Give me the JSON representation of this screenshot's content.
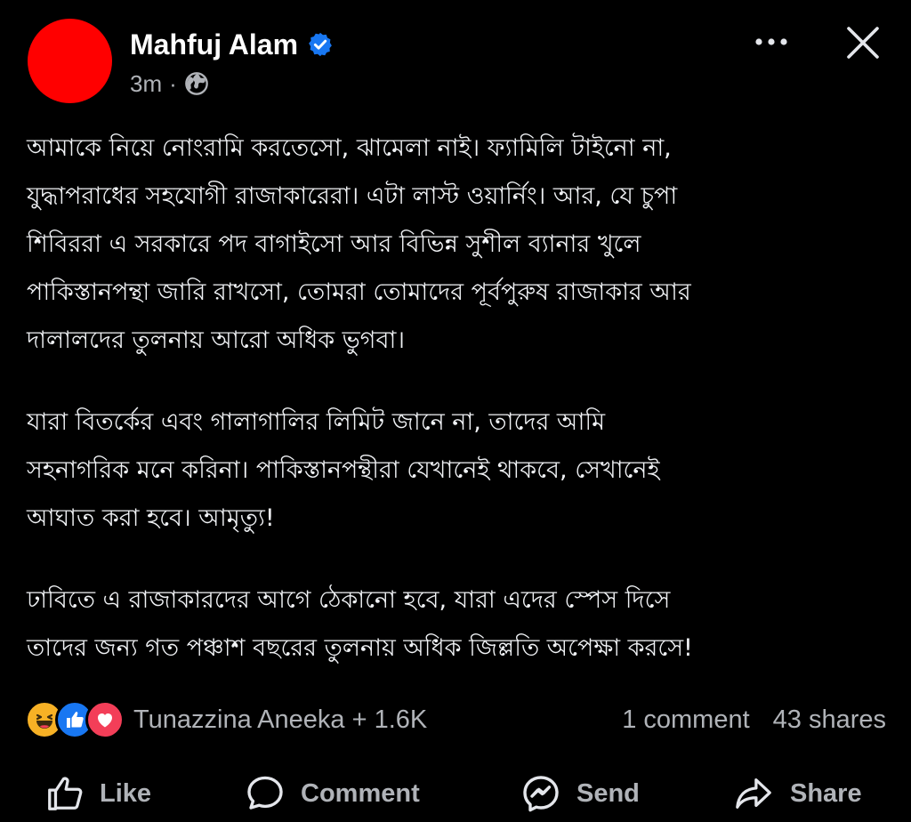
{
  "post": {
    "author": {
      "name": "Mahfuj Alam",
      "avatar_color": "#ff0000",
      "verified_icon": "verified-badge-icon",
      "verified_color": "#1877f2"
    },
    "meta": {
      "time": "3m",
      "separator": "·",
      "audience_icon": "globe-icon"
    },
    "body": {
      "paragraphs": [
        "আমাকে নিয়ে নোংরামি করতেসো, ঝামেলা নাই। ফ্যামিলি টাইনো না,\nযুদ্ধাপরাধের সহযোগী রাজাকারেরা। এটা লাস্ট ওয়ার্নিং। আর, যে চুপা\nশিবিররা এ সরকারে পদ বাগাইসো   আর বিভিন্ন সুশীল ব্যানার খুলে\nপাকিস্তানপন্থা জারি রাখসো, তোমরা তোমাদের পূর্বপুরুষ রাজাকার আর\nদালালদের তুলনায় আরো অধিক ভুগবা।",
        "যারা বিতর্কের এবং গালাগালির লিমিট জানে না, তাদের আমি\nসহনাগরিক মনে করিনা। পাকিস্তানপন্থীরা যেখানেই থাকবে, সেখানেই\nআঘাত করা হবে। আমৃত্যু!",
        "ঢাবিতে এ রাজাকারদের আগে ঠেকানো হবে, যারা এদের স্পেস দিসে\nতাদের জন্য গত পঞ্চাশ বছরের তুলনায় অধিক জিল্লতি অপেক্ষা করসে!"
      ]
    },
    "reactions": {
      "icons": [
        "haha-icon",
        "like-icon",
        "love-icon"
      ],
      "summary": "Tunazzina Aneeka + 1.6K",
      "comments": "1 comment",
      "shares": "43 shares"
    },
    "actions": {
      "like": "Like",
      "comment": "Comment",
      "send": "Send",
      "share": "Share"
    }
  },
  "colors": {
    "background": "#000000",
    "text_primary": "#f0f2f5",
    "text_secondary": "#b0b3b8",
    "like_blue": "#1877f2",
    "love_red": "#f33e58",
    "haha_yellow": "#f7b125"
  }
}
